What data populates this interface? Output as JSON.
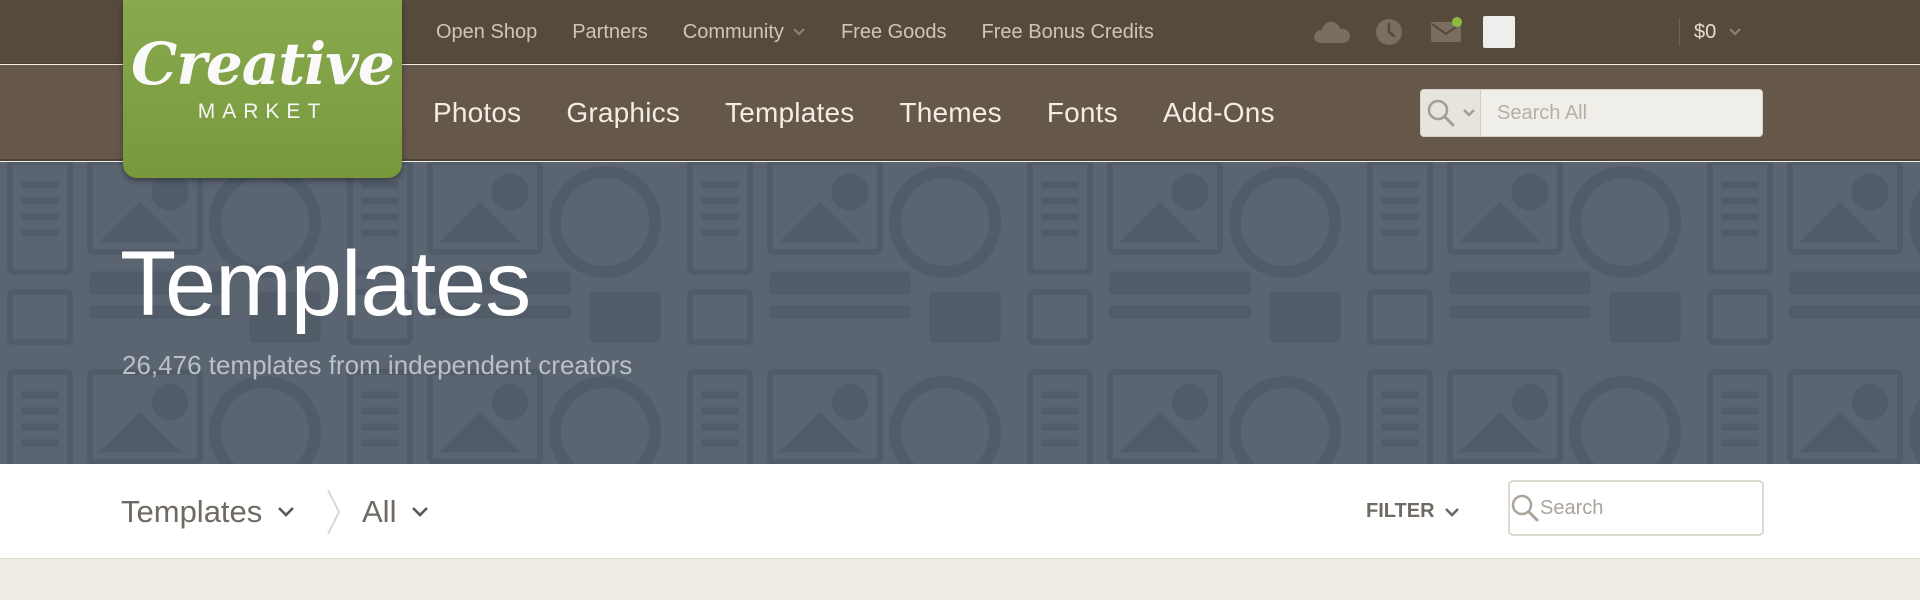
{
  "brand": {
    "logo_word": "Creative",
    "logo_sub": "MARKET",
    "logo_color": "#7fa23f"
  },
  "utility_nav": {
    "links": [
      "Open Shop",
      "Partners",
      "Community",
      "Free Goods",
      "Free Bonus Credits"
    ],
    "icons": [
      "cloud-icon",
      "clock-icon",
      "mail-icon"
    ],
    "cart_label": "$0",
    "notification_color": "#8dbb3b"
  },
  "main_nav": {
    "items": [
      "Photos",
      "Graphics",
      "Templates",
      "Themes",
      "Fonts",
      "Add-Ons"
    ],
    "search_placeholder": "Search All"
  },
  "hero": {
    "title": "Templates",
    "subtitle": "26,476 templates from independent creators"
  },
  "filter_bar": {
    "category": "Templates",
    "subcategory": "All",
    "filter_label": "FILTER",
    "search_placeholder": "Search"
  },
  "colors": {
    "topbar": "#564a3c",
    "mainnav": "#65574a",
    "hero": "#5b6471",
    "page_bg": "#efede6"
  }
}
